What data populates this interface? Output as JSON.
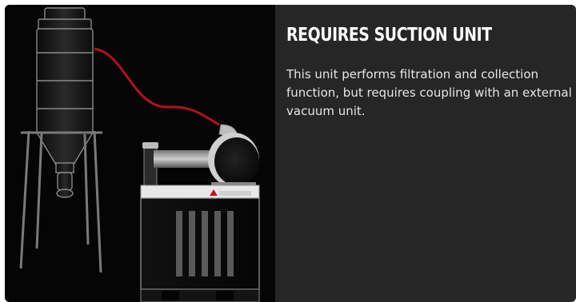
{
  "card": {
    "title": "REQUIRES SUCTION UNIT",
    "description": "This unit performs filtration and collection function, but requires coupling with an external vacuum unit."
  },
  "product_image": {
    "brand_label": "DEPURECO"
  },
  "colors": {
    "card_background": "#262626",
    "image_background": "#050505",
    "hose": "#b3121e",
    "title_text": "#ffffff",
    "body_text": "#e6e6e6"
  }
}
